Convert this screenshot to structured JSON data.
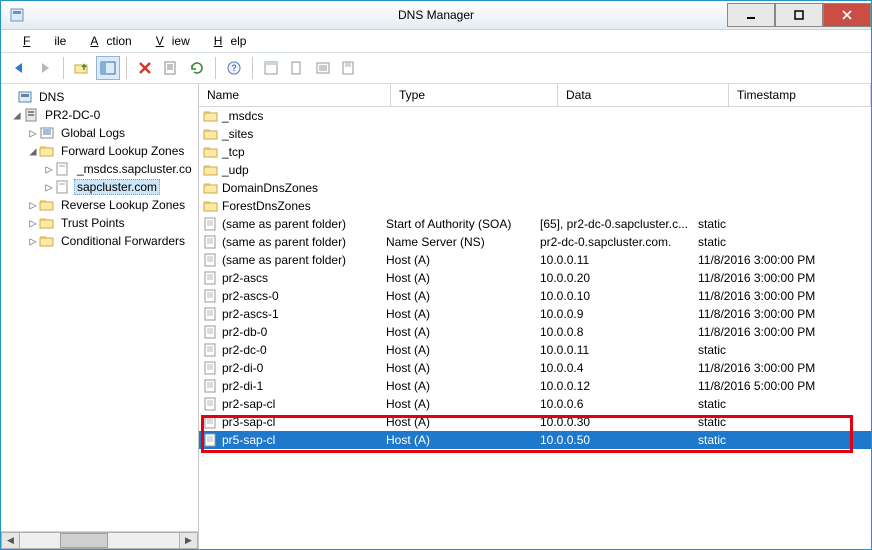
{
  "window": {
    "title": "DNS Manager"
  },
  "menu": {
    "file": "File",
    "action": "Action",
    "view": "View",
    "help": "Help"
  },
  "tree": {
    "root": "DNS",
    "server": "PR2-DC-0",
    "global_logs": "Global Logs",
    "fwd_zones": "Forward Lookup Zones",
    "zone_msdcs": "_msdcs.sapcluster.co",
    "zone_main": "sapcluster.com",
    "rev_zones": "Reverse Lookup Zones",
    "trust": "Trust Points",
    "cond_fwd": "Conditional Forwarders"
  },
  "columns": {
    "name": "Name",
    "type": "Type",
    "data": "Data",
    "timestamp": "Timestamp"
  },
  "records": [
    {
      "kind": "folder",
      "name": "_msdcs",
      "type": "",
      "data": "",
      "ts": ""
    },
    {
      "kind": "folder",
      "name": "_sites",
      "type": "",
      "data": "",
      "ts": ""
    },
    {
      "kind": "folder",
      "name": "_tcp",
      "type": "",
      "data": "",
      "ts": ""
    },
    {
      "kind": "folder",
      "name": "_udp",
      "type": "",
      "data": "",
      "ts": ""
    },
    {
      "kind": "folder",
      "name": "DomainDnsZones",
      "type": "",
      "data": "",
      "ts": ""
    },
    {
      "kind": "folder",
      "name": "ForestDnsZones",
      "type": "",
      "data": "",
      "ts": ""
    },
    {
      "kind": "record",
      "name": "(same as parent folder)",
      "type": "Start of Authority (SOA)",
      "data": "[65], pr2-dc-0.sapcluster.c...",
      "ts": "static"
    },
    {
      "kind": "record",
      "name": "(same as parent folder)",
      "type": "Name Server (NS)",
      "data": "pr2-dc-0.sapcluster.com.",
      "ts": "static"
    },
    {
      "kind": "record",
      "name": "(same as parent folder)",
      "type": "Host (A)",
      "data": "10.0.0.11",
      "ts": "11/8/2016 3:00:00 PM"
    },
    {
      "kind": "record",
      "name": "pr2-ascs",
      "type": "Host (A)",
      "data": "10.0.0.20",
      "ts": "11/8/2016 3:00:00 PM"
    },
    {
      "kind": "record",
      "name": "pr2-ascs-0",
      "type": "Host (A)",
      "data": "10.0.0.10",
      "ts": "11/8/2016 3:00:00 PM"
    },
    {
      "kind": "record",
      "name": "pr2-ascs-1",
      "type": "Host (A)",
      "data": "10.0.0.9",
      "ts": "11/8/2016 3:00:00 PM"
    },
    {
      "kind": "record",
      "name": "pr2-db-0",
      "type": "Host (A)",
      "data": "10.0.0.8",
      "ts": "11/8/2016 3:00:00 PM"
    },
    {
      "kind": "record",
      "name": "pr2-dc-0",
      "type": "Host (A)",
      "data": "10.0.0.11",
      "ts": "static"
    },
    {
      "kind": "record",
      "name": "pr2-di-0",
      "type": "Host (A)",
      "data": "10.0.0.4",
      "ts": "11/8/2016 3:00:00 PM"
    },
    {
      "kind": "record",
      "name": "pr2-di-1",
      "type": "Host (A)",
      "data": "10.0.0.12",
      "ts": "11/8/2016 5:00:00 PM"
    },
    {
      "kind": "record",
      "name": "pr2-sap-cl",
      "type": "Host (A)",
      "data": "10.0.0.6",
      "ts": "static"
    },
    {
      "kind": "record",
      "name": "pr3-sap-cl",
      "type": "Host (A)",
      "data": "10.0.0.30",
      "ts": "static"
    },
    {
      "kind": "record",
      "name": "pr5-sap-cl",
      "type": "Host (A)",
      "data": "10.0.0.50",
      "ts": "static",
      "selected": true,
      "highlighted": true
    }
  ]
}
